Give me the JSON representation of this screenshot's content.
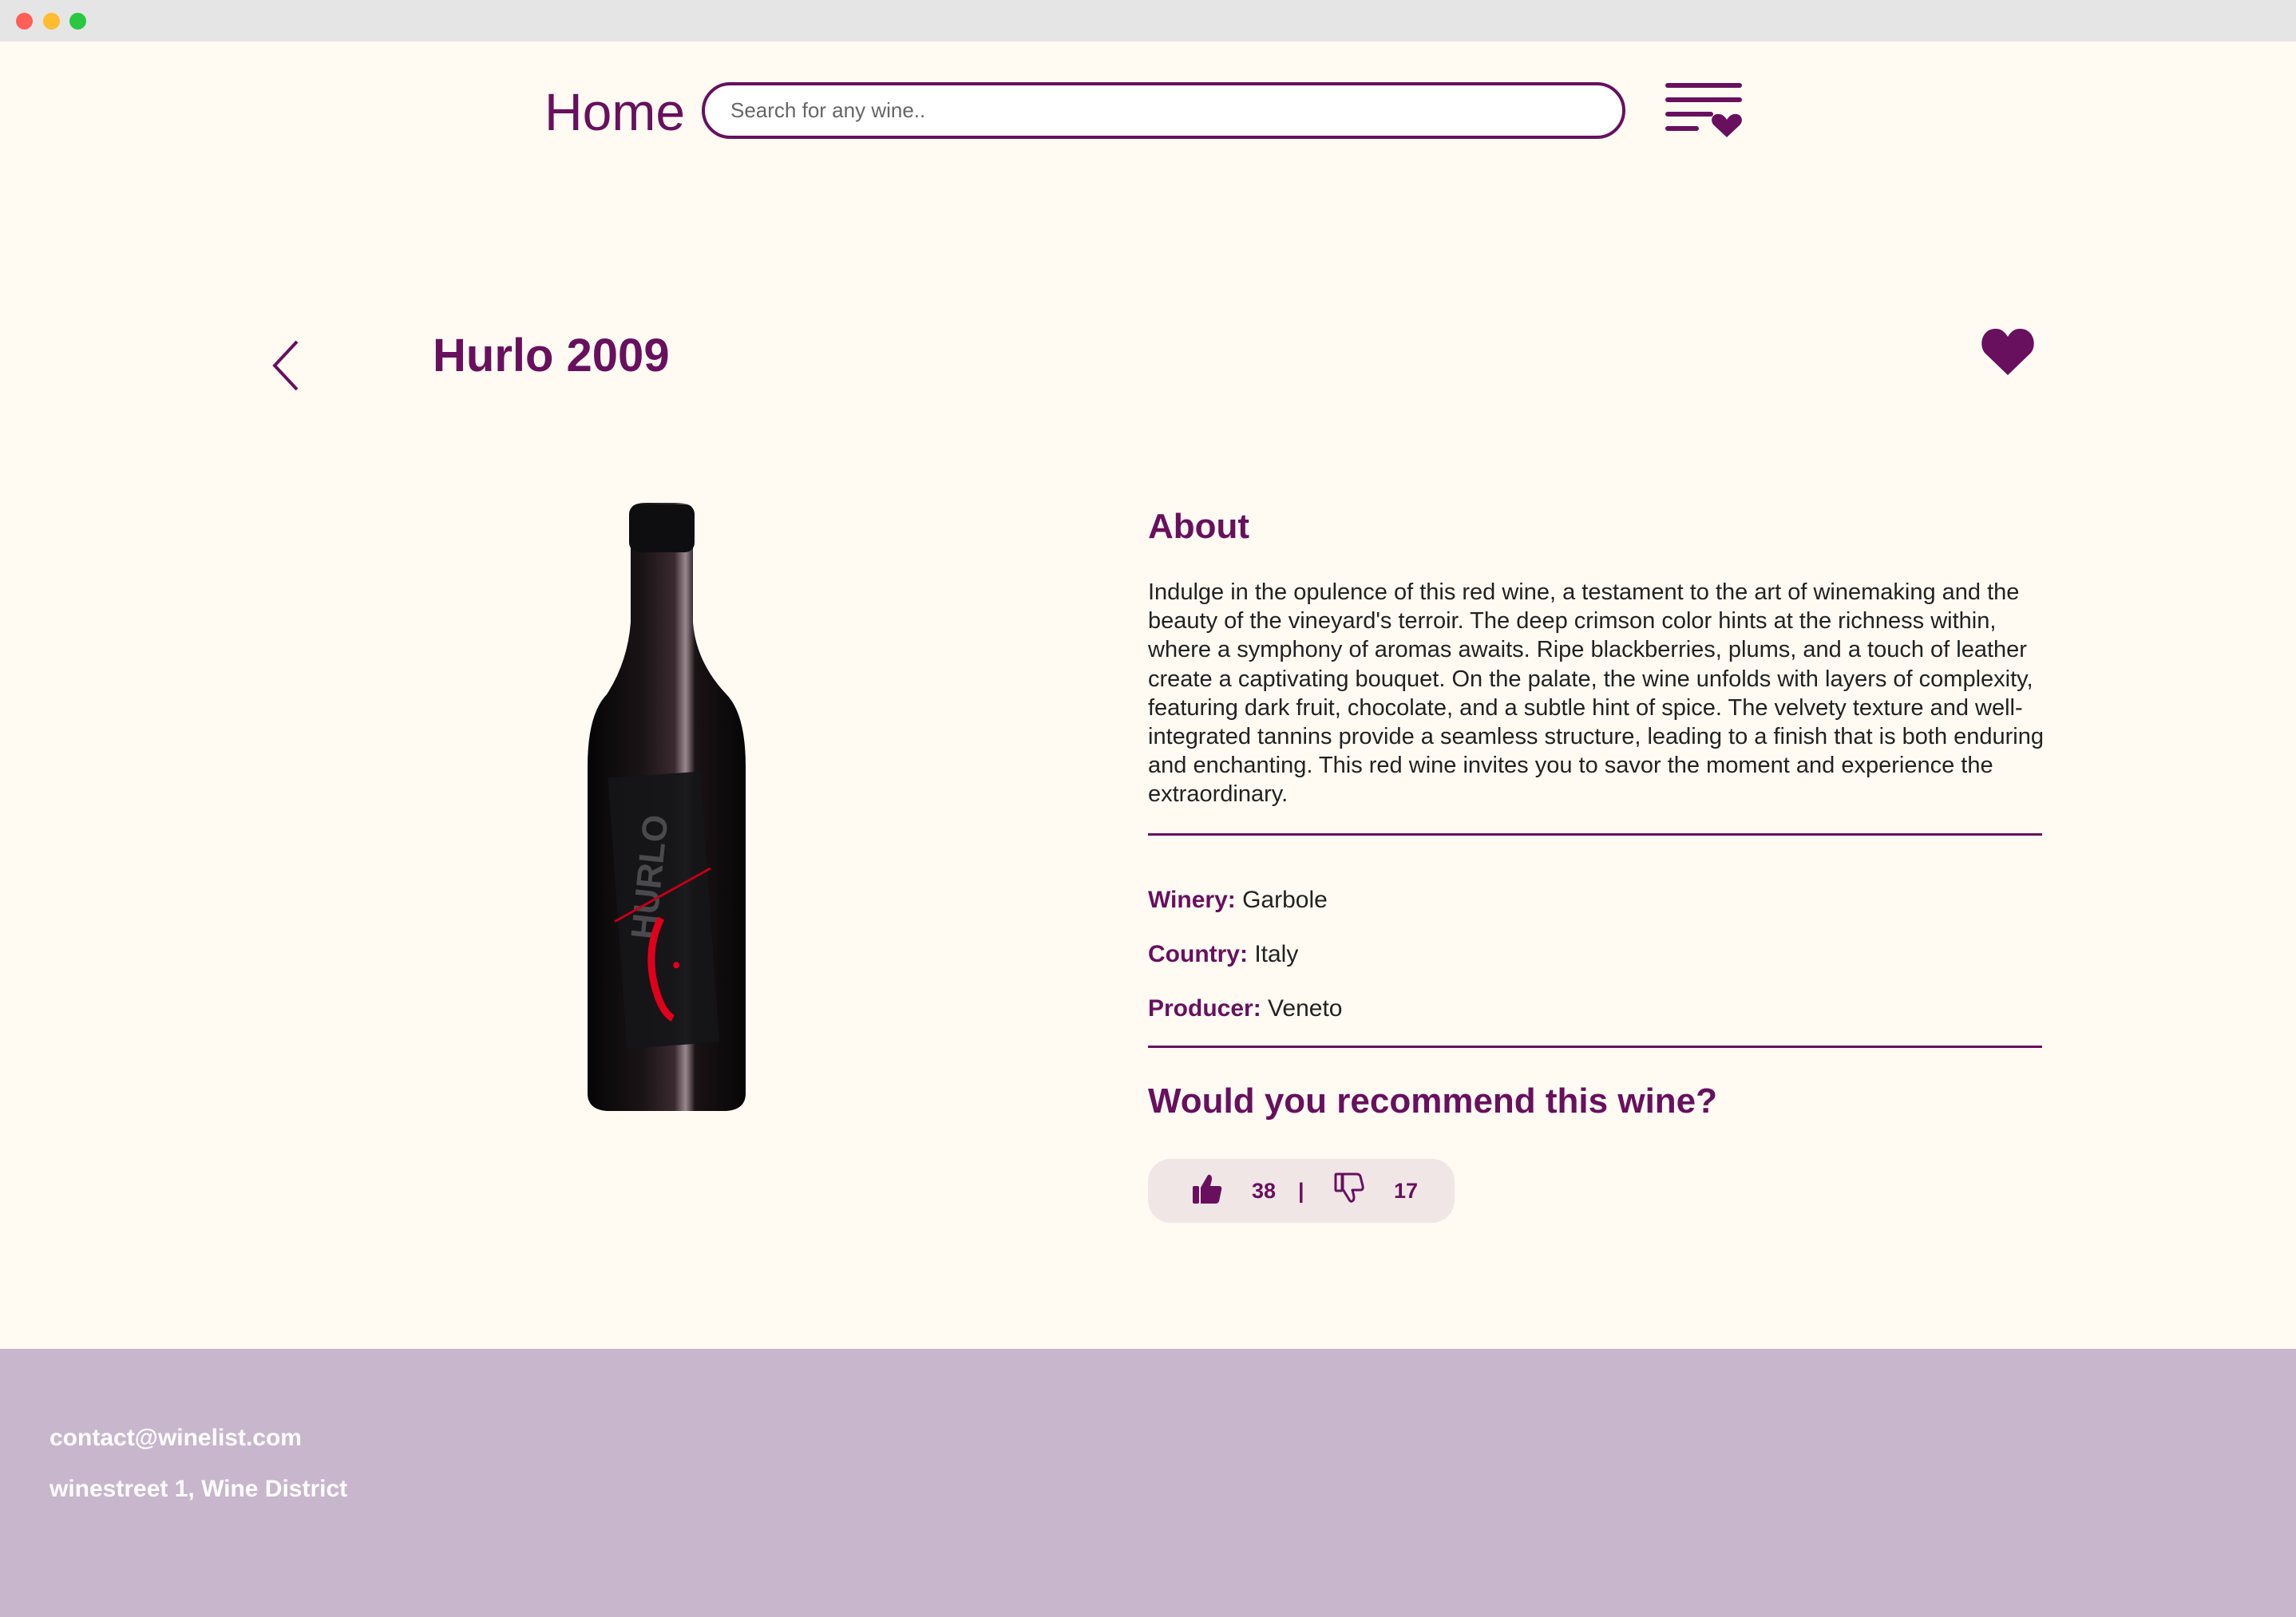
{
  "window": {
    "controls": [
      "close",
      "minimize",
      "maximize"
    ]
  },
  "header": {
    "home_label": "Home",
    "search_placeholder": "Search for any wine..",
    "favorites_list_icon": "list-heart-icon"
  },
  "wine": {
    "title": "Hurlo 2009",
    "favorite_icon": "heart-icon",
    "bottle_label_text": "HURLO"
  },
  "about": {
    "heading": "About",
    "text": "Indulge in the opulence of this red wine, a testament to the art of winemaking and the beauty of the vineyard's terroir. The deep crimson color hints at the richness within, where a symphony of aromas awaits. Ripe blackberries, plums, and a touch of leather create a captivating bouquet. On the palate, the wine unfolds with layers of complexity, featuring dark fruit, chocolate, and a subtle hint of spice. The velvety texture and well-integrated tannins provide a seamless structure, leading to a finish that is both enduring and enchanting. This red wine invites you to savor the moment and experience the extraordinary."
  },
  "details": {
    "winery_label": "Winery:",
    "winery_value": "Garbole",
    "country_label": "Country:",
    "country_value": "Italy",
    "producer_label": "Producer:",
    "producer_value": "Veneto"
  },
  "recommend": {
    "heading": "Would you recommend this wine?",
    "up_count": "38",
    "separator": "|",
    "down_count": "17"
  },
  "footer": {
    "email": "contact@winelist.com",
    "address": "winestreet 1, Wine District"
  },
  "colors": {
    "accent": "#68105e",
    "background": "#fffbf3",
    "footer": "#c8b6cd",
    "vote_box": "#f1e6e6"
  }
}
